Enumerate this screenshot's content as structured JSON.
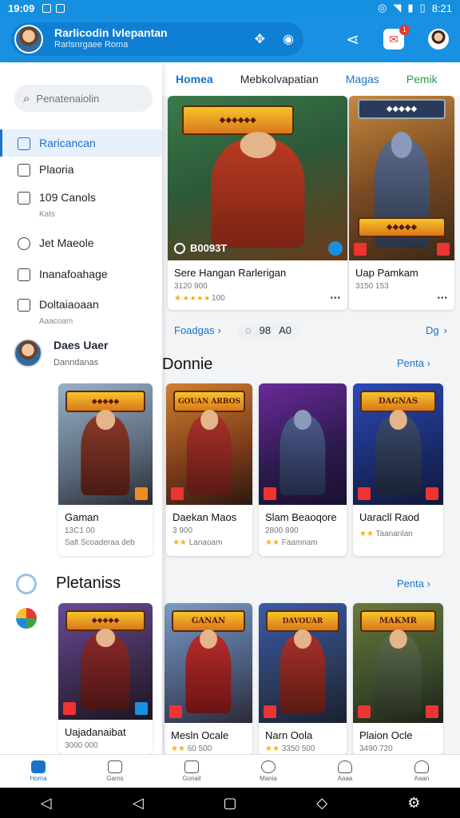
{
  "status_bar": {
    "time": "19:09",
    "right_time": "8:21"
  },
  "app_bar": {
    "title": "Rarlicodin lvlepantan",
    "subtitle": "Rarlsnrgaee Roma",
    "notification_count": "1"
  },
  "sidebar": {
    "search_placeholder": "Penatenaiolin",
    "items": [
      {
        "label": "Raricancan",
        "sub": ""
      },
      {
        "label": "Plaoria",
        "sub": ""
      },
      {
        "label": "109 Canols",
        "sub": "Kats"
      },
      {
        "label": "Jet Maeole",
        "sub": ""
      },
      {
        "label": "Inanafoahage",
        "sub": ""
      },
      {
        "label": "Doltaiaoaan",
        "sub": "Aaacoam"
      }
    ],
    "user": {
      "name": "Daes Uaer",
      "sub": "Danndanas"
    }
  },
  "tabs": [
    "Homea",
    "Mebkolvapatian",
    "Magas",
    "Pemik"
  ],
  "featured": [
    {
      "title": "Sere Hangan Rarlerigan",
      "meta": "3120 900",
      "play_label": "B0093T",
      "stats": "100"
    },
    {
      "title": "Uap Pamkam",
      "meta": "3150 153",
      "play_label": "",
      "stats": ""
    }
  ],
  "filter_bar": {
    "left": "Foadgas",
    "count1": "98",
    "count2": "A0",
    "right": "Dg"
  },
  "section1": {
    "title": "Donnie",
    "see_all": "Penta",
    "sidebar_card": {
      "title": "Gaman",
      "meta1": "13C1 00",
      "meta2": "Salt Scoaderaa deb"
    },
    "cards": [
      {
        "title": "Daekan Maos",
        "meta": "3 900",
        "sub": "Lanaoam",
        "logo": "GOUAN ARBOS"
      },
      {
        "title": "Slam Beaoqore",
        "meta": "2800 890",
        "sub": "Faamnam",
        "logo": ""
      },
      {
        "title": "Uaracll Raod",
        "meta": "",
        "sub": "Taananlan",
        "logo": "DAGNAS"
      }
    ]
  },
  "section2": {
    "title": "Pletaniss",
    "see_all": "Penta",
    "sidebar_card": {
      "title": "Uajadanaibat",
      "meta": "3000 000"
    },
    "cards": [
      {
        "title": "Mesln Ocale",
        "meta": "60 500",
        "logo": "GANAN"
      },
      {
        "title": "Narn Oola",
        "meta": "3350 500",
        "logo": "DAVOUAR"
      },
      {
        "title": "Plaion Ocle",
        "meta": "3490 720",
        "logo": "MAKMR"
      }
    ]
  },
  "bottom_nav": [
    "Homa",
    "Gams",
    "Gonail",
    "Mania",
    "Aaaa",
    "Aaan"
  ],
  "colors": {
    "primary": "#1891e3",
    "accent": "#1a73c9",
    "star": "#f5b50a"
  }
}
